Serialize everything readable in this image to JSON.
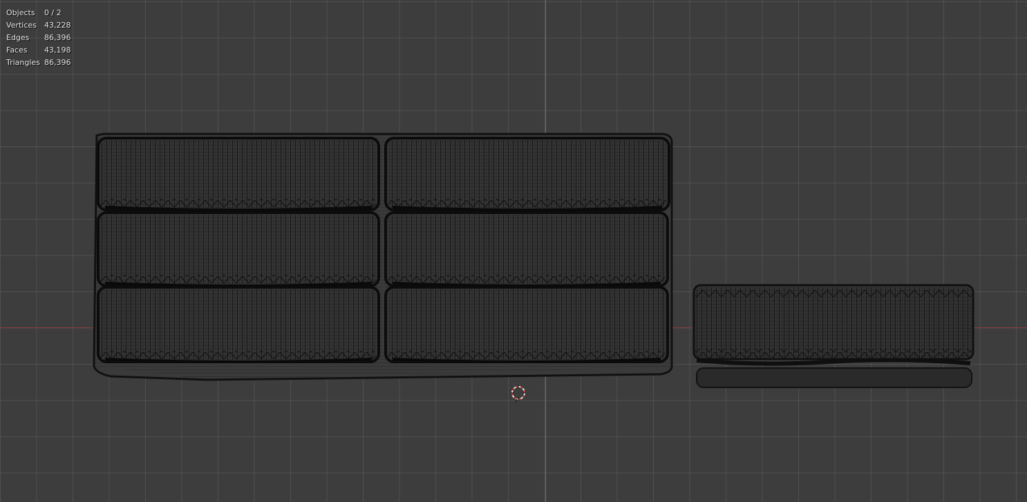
{
  "overlay": {
    "stats": [
      {
        "label": "Objects",
        "value": "0 / 2"
      },
      {
        "label": "Vertices",
        "value": "43,228"
      },
      {
        "label": "Edges",
        "value": "86,396"
      },
      {
        "label": "Faces",
        "value": "43,198"
      },
      {
        "label": "Triangles",
        "value": "86,396"
      }
    ]
  },
  "colors": {
    "background": "#3d3d3d",
    "grid": "#525252",
    "x_axis": "#8b3a3a",
    "y_axis": "#4a78b0",
    "wire": "#151515"
  },
  "icons": {
    "cursor": "3d-cursor-icon"
  }
}
